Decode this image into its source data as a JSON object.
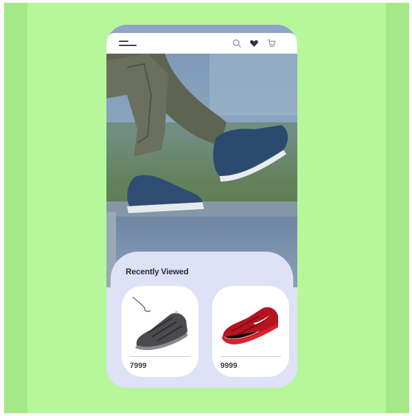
{
  "header": {
    "menu_icon": "hamburger-menu-icon",
    "search_icon": "search-icon",
    "favorites_icon": "heart-icon",
    "cart_icon": "cart-icon"
  },
  "hero": {
    "image": "person-walking-blue-sneakers-photo"
  },
  "recently_viewed": {
    "title": "Recently Viewed",
    "items": [
      {
        "image": "black-sneaker",
        "price": "7999"
      },
      {
        "image": "red-sneaker",
        "price": "9999"
      }
    ]
  },
  "colors": {
    "background": "#b6f79c",
    "side_bands": "#a4e889",
    "card_background": "#dfe2f6",
    "text": "#2b2d3a"
  }
}
